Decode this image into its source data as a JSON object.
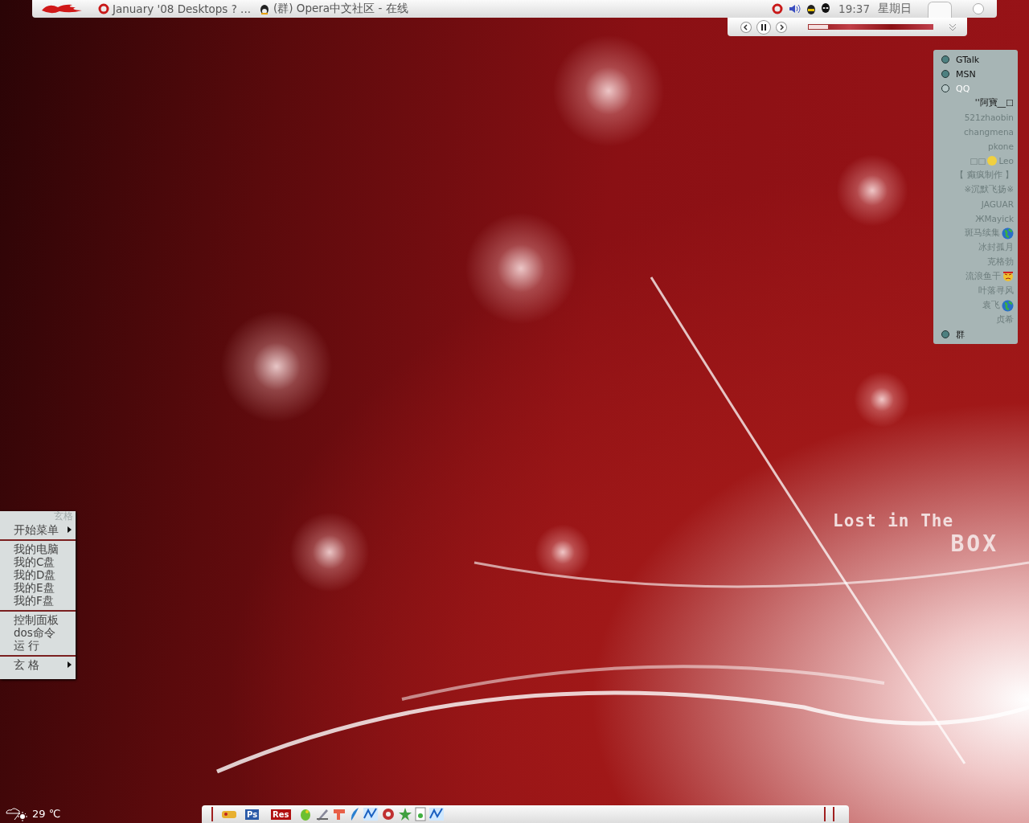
{
  "top_bar": {
    "tasks": [
      {
        "kind": "opera",
        "label": "January '08 Desktops ? ..."
      },
      {
        "kind": "qq",
        "label": "(群) Opera中文社区 - 在线"
      }
    ],
    "tray": {
      "clock": "19:37",
      "day": "星期日"
    }
  },
  "media_player": {
    "level": 0.17
  },
  "contacts": {
    "accounts": [
      {
        "name": "GTalk",
        "selected": false,
        "expanded": false
      },
      {
        "name": "MSN",
        "selected": false,
        "expanded": false
      },
      {
        "name": "QQ",
        "selected": true,
        "expanded": true,
        "children": [
          {
            "name": "''阿寶__□"
          },
          {
            "name": "521zhaobin"
          },
          {
            "name": "changmena"
          },
          {
            "name": "pkone"
          },
          {
            "prefix": "□□",
            "kind": "smiley",
            "name": "Leo"
          },
          {
            "name": "【 癫疯制作 】"
          },
          {
            "name": "※沉默飞扬※"
          },
          {
            "name": "JAGUAR"
          },
          {
            "name": "ЖMayick"
          },
          {
            "name": "斑马续集",
            "kind": "globe"
          },
          {
            "name": "冰封孤月"
          },
          {
            "name": "克格勃"
          },
          {
            "name": "流浪鱼干",
            "kind": "angry"
          },
          {
            "name": "叶落寻风"
          },
          {
            "name": "袁飞",
            "kind": "globe"
          },
          {
            "name": "贞希"
          }
        ]
      },
      {
        "name": "群",
        "selected": false,
        "expanded": false
      }
    ]
  },
  "start_menu": {
    "header": "玄格",
    "sections": [
      [
        {
          "label": "开始菜单",
          "submenu": true
        }
      ],
      [
        {
          "label": "我的电脑",
          "submenu": false
        },
        {
          "label": "我的C盘",
          "submenu": false
        },
        {
          "label": "我的D盘",
          "submenu": false
        },
        {
          "label": "我的E盘",
          "submenu": false
        },
        {
          "label": "我的F盘",
          "submenu": false
        }
      ],
      [
        {
          "label": "控制面板",
          "submenu": false
        },
        {
          "label": "dos命令",
          "submenu": false
        },
        {
          "label": "运 行",
          "submenu": false
        }
      ],
      [
        {
          "label": "玄 格",
          "submenu": true
        }
      ]
    ]
  },
  "weather": {
    "temperature": "29 ℃"
  },
  "wallpaper": {
    "line_1": "Lost in The",
    "line_2": "BOX"
  },
  "taskbar": {
    "icons": [
      {
        "kind": "toy"
      },
      {
        "kind": "tile",
        "label": "Ps",
        "color": "#2a5aa8"
      },
      {
        "kind": "tile",
        "label": "Res",
        "color": "#b01010"
      },
      {
        "kind": "parrot"
      },
      {
        "kind": "pen"
      },
      {
        "kind": "shape"
      },
      {
        "kind": "feather"
      },
      {
        "kind": "wave"
      },
      {
        "kind": "shield"
      },
      {
        "kind": "star"
      },
      {
        "kind": "doc"
      },
      {
        "kind": "wave"
      }
    ]
  }
}
